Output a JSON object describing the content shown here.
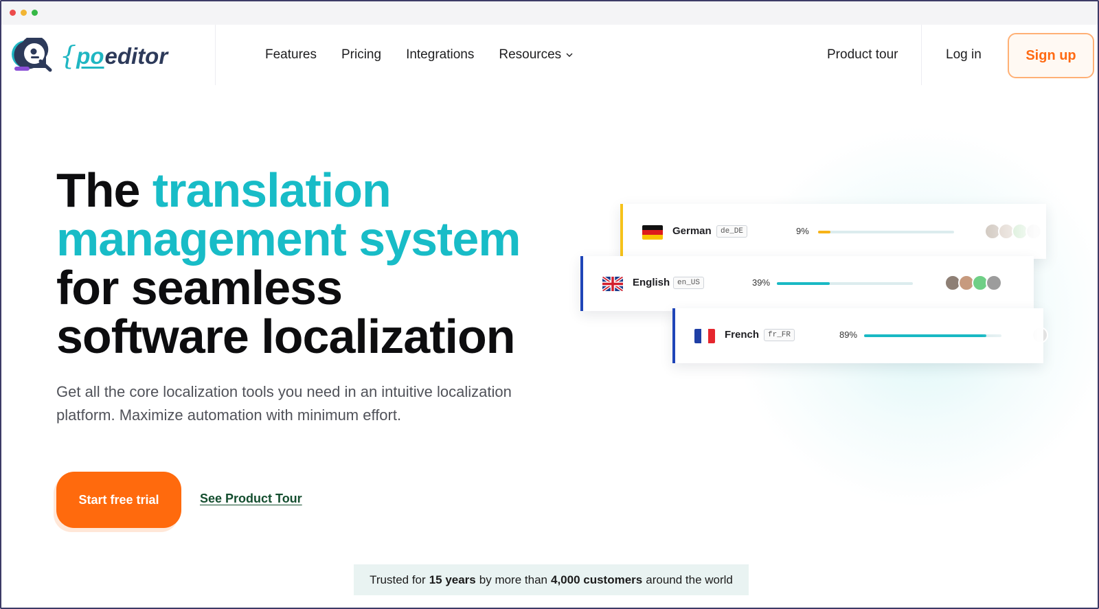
{
  "brand": {
    "brace": "{",
    "po": "po",
    "editor": "editor"
  },
  "nav": {
    "items": [
      {
        "label": "Features"
      },
      {
        "label": "Pricing"
      },
      {
        "label": "Integrations"
      },
      {
        "label": "Resources"
      }
    ],
    "product_tour": "Product tour",
    "login": "Log in",
    "signup": "Sign up"
  },
  "hero": {
    "title_1": "The ",
    "title_accent_1": "translation",
    "title_accent_2": "management system",
    "title_2": "for seamless",
    "title_3": "software localization",
    "subtitle_line_1": "Get all the core localization tools you need in an intuitive localization",
    "subtitle_line_2": "platform. Maximize automation with minimum effort.",
    "cta_primary": "Start free trial",
    "cta_secondary": "See Product Tour"
  },
  "trust": {
    "prefix": "Trusted for",
    "years": "15 years",
    "middle": "by more than",
    "customers": "4,000 customers",
    "suffix": "around the world"
  },
  "languages": [
    {
      "name": "German",
      "code": "de_DE",
      "percent_label": "9%",
      "progress": 0.09,
      "accent": "#f6c21a"
    },
    {
      "name": "English",
      "code": "en_US",
      "percent_label": "39%",
      "progress": 0.39,
      "accent": "#1f45b8"
    },
    {
      "name": "French",
      "code": "fr_FR",
      "percent_label": "89%",
      "progress": 0.89,
      "accent": "#1f45b8"
    }
  ],
  "colors": {
    "accent_teal": "#18bcc7",
    "cta_orange": "#ff6a0d",
    "progress_teal": "#19b9c4",
    "progress_yellow": "#f7b318"
  }
}
